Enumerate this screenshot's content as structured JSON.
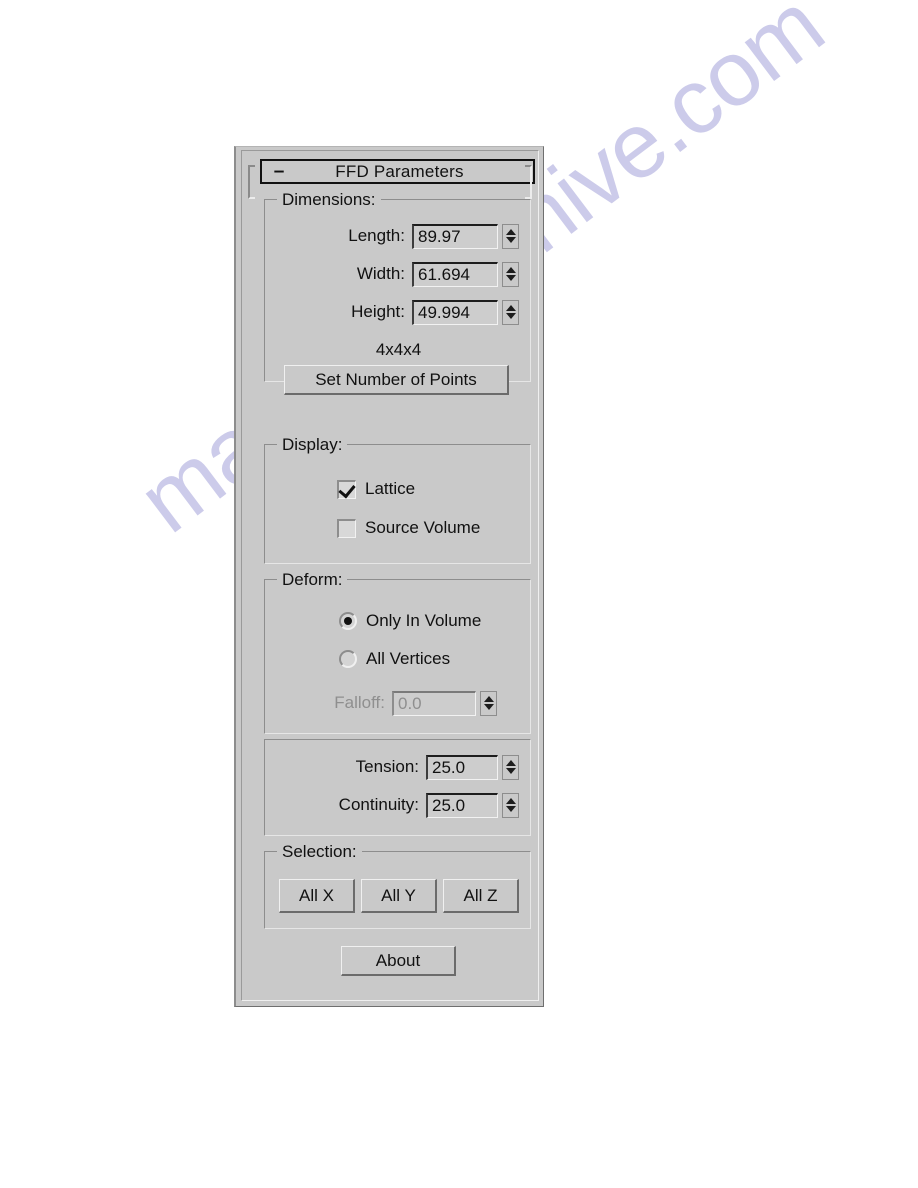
{
  "watermark": {
    "text": "manualsarchive.com"
  },
  "rollout": {
    "toggle_glyph": "–",
    "title": "FFD Parameters"
  },
  "dimensions": {
    "title": "Dimensions:",
    "fields": [
      {
        "label": "Length:",
        "value": "89.97"
      },
      {
        "label": "Width:",
        "value": "61.694"
      },
      {
        "label": "Height:",
        "value": "49.994"
      }
    ],
    "points_text": "4x4x4",
    "set_points_button": "Set Number of Points"
  },
  "display": {
    "title": "Display:",
    "items": [
      {
        "label": "Lattice",
        "checked": true
      },
      {
        "label": "Source Volume",
        "checked": false
      }
    ]
  },
  "deform": {
    "title": "Deform:",
    "options": [
      {
        "label": "Only In Volume",
        "selected": true
      },
      {
        "label": "All Vertices",
        "selected": false
      }
    ],
    "falloff": {
      "label": "Falloff:",
      "value": "0.0",
      "disabled": true
    }
  },
  "curve": {
    "fields": [
      {
        "label": "Tension:",
        "value": "25.0"
      },
      {
        "label": "Continuity:",
        "value": "25.0"
      }
    ]
  },
  "selection": {
    "title": "Selection:",
    "buttons": [
      "All X",
      "All Y",
      "All Z"
    ]
  },
  "about_button": "About",
  "colors": {
    "panel_bg": "#c9c9c9",
    "text": "#111111",
    "disabled_text": "#8f8f8f",
    "watermark": "#b9b8e2"
  }
}
